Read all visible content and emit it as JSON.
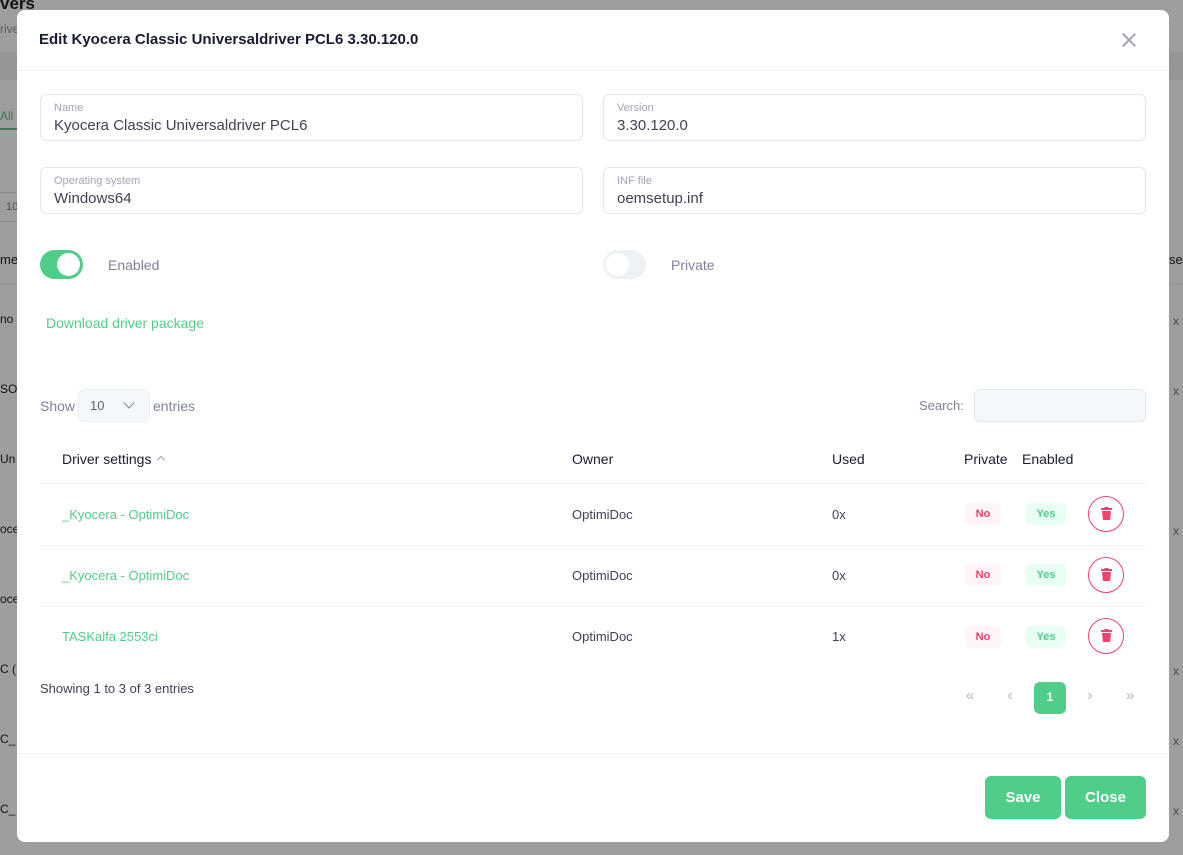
{
  "background": {
    "title_fragment": "vers",
    "subtitle_fragment": "rive",
    "tab_fragment": "All",
    "select_fragment": "10",
    "col_left_fragment": "me",
    "col_right_fragment": "sed",
    "rows_left": [
      "no",
      "SON",
      "Un",
      "oce",
      "oce",
      "C (",
      "C_",
      "C_"
    ],
    "rows_right": "x"
  },
  "modal": {
    "title": "Edit Kyocera Classic Universaldriver PCL6 3.30.120.0",
    "fields": {
      "name": {
        "label": "Name",
        "value": "Kyocera Classic Universaldriver PCL6"
      },
      "version": {
        "label": "Version",
        "value": "3.30.120.0"
      },
      "os": {
        "label": "Operating system",
        "value": "Windows64"
      },
      "inf": {
        "label": "INF file",
        "value": "oemsetup.inf"
      }
    },
    "toggles": {
      "enabled": {
        "label": "Enabled",
        "state": "on"
      },
      "private": {
        "label": "Private",
        "state": "off"
      }
    },
    "download_link": "Download driver package",
    "table": {
      "show_label": "Show",
      "entries_value": "10",
      "entries_label": "entries",
      "search_label": "Search:",
      "columns": [
        "Driver settings",
        "Owner",
        "Used",
        "Private",
        "Enabled"
      ],
      "rows": [
        {
          "setting": "_Kyocera - OptimiDoc",
          "owner": "OptimiDoc",
          "used": "0x",
          "private": "No",
          "enabled": "Yes"
        },
        {
          "setting": "_Kyocera - OptimiDoc",
          "owner": "OptimiDoc",
          "used": "0x",
          "private": "No",
          "enabled": "Yes"
        },
        {
          "setting": "TASKalfa 2553ci",
          "owner": "OptimiDoc",
          "used": "1x",
          "private": "No",
          "enabled": "Yes"
        }
      ],
      "info": "Showing 1 to 3 of 3 entries",
      "pagination": {
        "first": "«",
        "prev": "‹",
        "current": "1",
        "next": "›",
        "last": "»"
      }
    },
    "buttons": {
      "save": "Save",
      "close": "Close"
    }
  },
  "colors": {
    "accent": "#50cd89",
    "danger": "#f1416c"
  }
}
